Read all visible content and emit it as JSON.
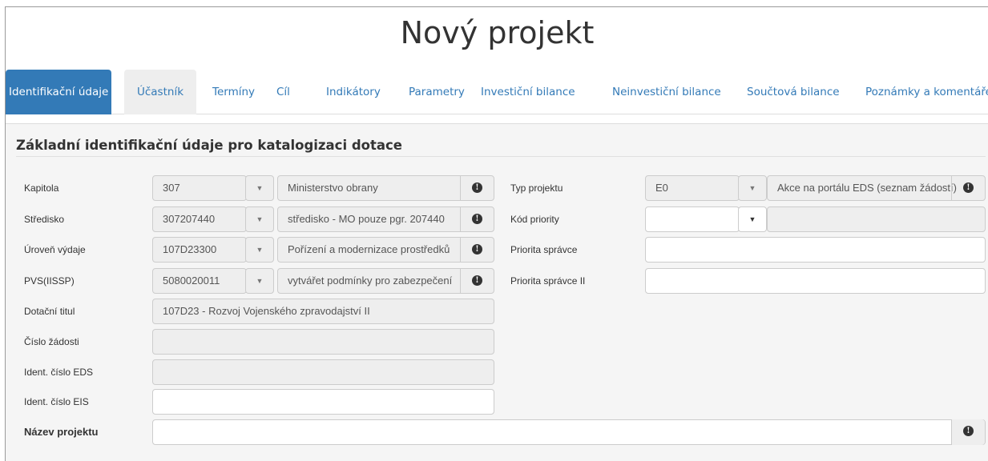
{
  "page_title": "Nový projekt",
  "tabs": [
    {
      "label": "Identifikační údaje"
    },
    {
      "label": "Účastník"
    },
    {
      "label": "Termíny"
    },
    {
      "label": "Cíl"
    },
    {
      "label": "Indikátory"
    },
    {
      "label": "Parametry"
    },
    {
      "label": "Investiční bilance"
    },
    {
      "label": "Neinvestiční bilance"
    },
    {
      "label": "Součtová bilance"
    },
    {
      "label": "Poznámky a komentáře"
    }
  ],
  "section_title": "Základní identifikační údaje pro katalogizaci dotace",
  "left_fields": {
    "kapitola": {
      "label": "Kapitola",
      "code": "307",
      "desc": "Ministerstvo obrany"
    },
    "stredisko": {
      "label": "Středisko",
      "code": "307207440",
      "desc": "středisko - MO pouze pgr. 207440"
    },
    "uroven": {
      "label": "Úroveň výdaje",
      "code": "107D23300",
      "desc": "Pořízení a modernizace prostředků"
    },
    "pvs": {
      "label": "PVS(IISSP)",
      "code": "5080020011",
      "desc": "vytvářet podmínky pro zabezpečení"
    },
    "dotacni_titul": {
      "label": "Dotační titul",
      "value": "107D23 - Rozvoj Vojenského zpravodajství II"
    },
    "cislo_zadosti": {
      "label": "Číslo žádosti",
      "value": ""
    },
    "eds": {
      "label": "Ident. číslo EDS",
      "value": ""
    },
    "eis": {
      "label": "Ident. číslo EIS",
      "value": ""
    }
  },
  "right_fields": {
    "typ_projektu": {
      "label": "Typ projektu",
      "code": "E0",
      "desc": "Akce na portálu EDS (seznam žádostí)"
    },
    "kod_priority": {
      "label": "Kód priority",
      "code": "",
      "desc": ""
    },
    "priorita_spravce": {
      "label": "Priorita správce",
      "value": ""
    },
    "priorita_spravce_ii": {
      "label": "Priorita správce II",
      "value": ""
    }
  },
  "nazev_projektu": {
    "label": "Název projektu",
    "value": ""
  },
  "icons": {
    "dropdown": "caret-down-icon",
    "info": "info-icon"
  },
  "colors": {
    "accent": "#337ab7",
    "panel": "#f5f5f5"
  }
}
